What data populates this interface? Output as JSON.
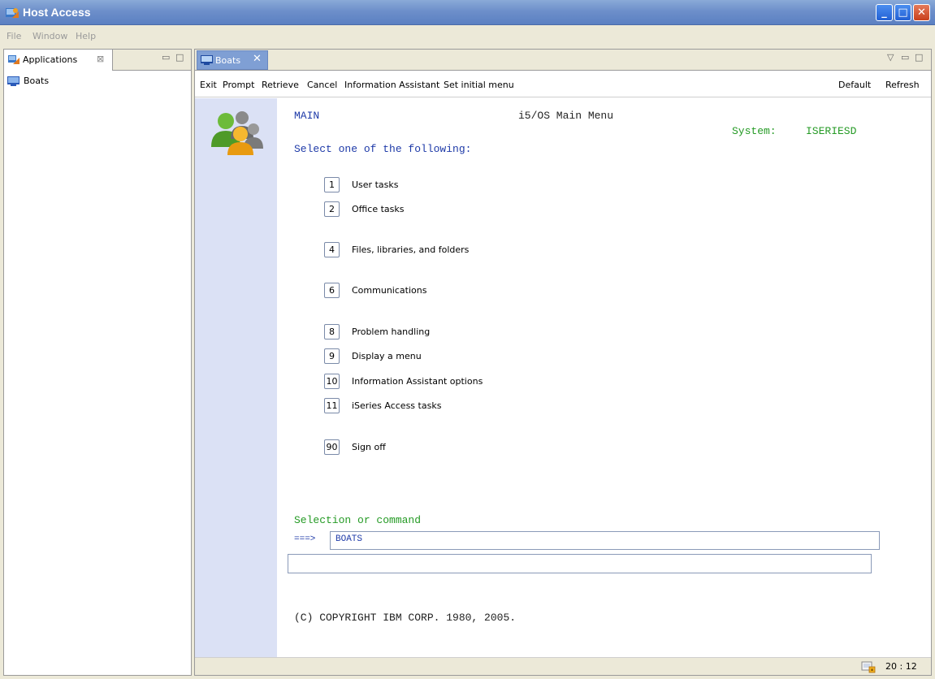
{
  "window": {
    "title": "Host Access"
  },
  "menu": {
    "items": [
      "File",
      "Window",
      "Help"
    ]
  },
  "left_panel": {
    "tab_label": "Applications",
    "tree_items": [
      "Boats"
    ]
  },
  "editor": {
    "tab_label": "Boats",
    "toolbar_left": [
      "Exit",
      "Prompt",
      "Retrieve",
      "Cancel",
      "Information Assistant",
      "Set initial menu"
    ],
    "toolbar_right": [
      "Default",
      "Refresh"
    ]
  },
  "screen": {
    "menu_id": "MAIN",
    "menu_title": "i5/OS Main Menu",
    "system_label": "System:",
    "system_name": "ISERIESD",
    "instruction": "Select one of the following:",
    "options": [
      {
        "number": "1",
        "label": "User tasks"
      },
      {
        "number": "2",
        "label": "Office tasks"
      },
      {
        "number": "4",
        "label": "Files, libraries, and folders"
      },
      {
        "number": "6",
        "label": "Communications"
      },
      {
        "number": "8",
        "label": "Problem handling"
      },
      {
        "number": "9",
        "label": "Display a menu"
      },
      {
        "number": "10",
        "label": "Information Assistant options"
      },
      {
        "number": "11",
        "label": "iSeries Access tasks"
      },
      {
        "number": "90",
        "label": "Sign off"
      }
    ],
    "selection_label": "Selection or command",
    "prompt_arrow": "===>",
    "command_value": "BOATS",
    "command_value_2": "",
    "copyright": "(C) COPYRIGHT IBM CORP. 1980, 2005."
  },
  "status": {
    "time": "20 : 12"
  },
  "colors": {
    "title_bar": "#6d8fca",
    "side_strip": "#dbe1f5",
    "screen_blue": "#1e3aa8",
    "screen_green": "#249a24"
  }
}
